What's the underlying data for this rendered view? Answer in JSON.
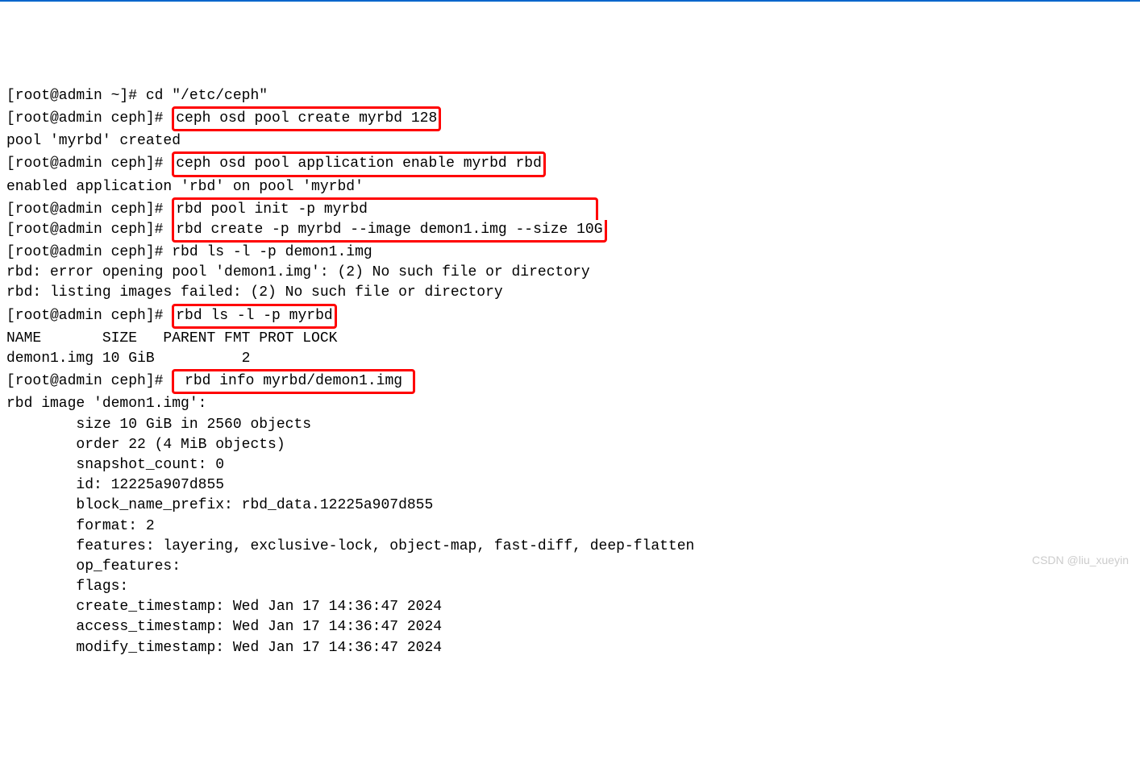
{
  "lines": [
    {
      "segments": [
        {
          "text": "[root@admin ~]# cd \"/etc/ceph\""
        }
      ]
    },
    {
      "segments": [
        {
          "text": "[root@admin ceph]# "
        },
        {
          "text": "ceph osd pool create myrbd 128",
          "highlight": true
        }
      ]
    },
    {
      "segments": [
        {
          "text": "pool 'myrbd' created"
        }
      ]
    },
    {
      "segments": [
        {
          "text": "[root@admin ceph]# "
        },
        {
          "text": "ceph osd pool application enable myrbd rbd",
          "highlight": true
        }
      ]
    },
    {
      "segments": [
        {
          "text": "enabled application 'rbd' on pool 'myrbd'"
        }
      ]
    },
    {
      "segments": [
        {
          "text": "[root@admin ceph]# "
        },
        {
          "text": "rbd pool init -p myrbd                          ",
          "highlight": true,
          "joinNext": true
        }
      ]
    },
    {
      "segments": [
        {
          "text": "[root@admin ceph]# "
        },
        {
          "text": "rbd create -p myrbd --image demon1.img --size 10G",
          "highlight": true,
          "joinPrev": true
        }
      ]
    },
    {
      "segments": [
        {
          "text": "[root@admin ceph]# rbd ls -l -p demon1.img"
        }
      ]
    },
    {
      "segments": [
        {
          "text": "rbd: error opening pool 'demon1.img': (2) No such file or directory"
        }
      ]
    },
    {
      "segments": [
        {
          "text": "rbd: listing images failed: (2) No such file or directory"
        }
      ]
    },
    {
      "segments": [
        {
          "text": "[root@admin ceph]# "
        },
        {
          "text": "rbd ls -l -p myrbd",
          "highlight": true
        }
      ]
    },
    {
      "segments": [
        {
          "text": "NAME       SIZE   PARENT FMT PROT LOCK"
        }
      ]
    },
    {
      "segments": [
        {
          "text": "demon1.img 10 GiB          2"
        }
      ]
    },
    {
      "segments": [
        {
          "text": "[root@admin ceph]# "
        },
        {
          "text": " rbd info myrbd/demon1.img ",
          "highlight": true
        }
      ]
    },
    {
      "segments": [
        {
          "text": "rbd image 'demon1.img':"
        }
      ]
    },
    {
      "segments": [
        {
          "text": "        size 10 GiB in 2560 objects"
        }
      ]
    },
    {
      "segments": [
        {
          "text": "        order 22 (4 MiB objects)"
        }
      ]
    },
    {
      "segments": [
        {
          "text": "        snapshot_count: 0"
        }
      ]
    },
    {
      "segments": [
        {
          "text": "        id: 12225a907d855"
        }
      ]
    },
    {
      "segments": [
        {
          "text": "        block_name_prefix: rbd_data.12225a907d855"
        }
      ]
    },
    {
      "segments": [
        {
          "text": "        format: 2"
        }
      ]
    },
    {
      "segments": [
        {
          "text": "        features: layering, exclusive-lock, object-map, fast-diff, deep-flatten"
        }
      ]
    },
    {
      "segments": [
        {
          "text": "        op_features:"
        }
      ]
    },
    {
      "segments": [
        {
          "text": "        flags:"
        }
      ]
    },
    {
      "segments": [
        {
          "text": "        create_timestamp: Wed Jan 17 14:36:47 2024"
        }
      ]
    },
    {
      "segments": [
        {
          "text": "        access_timestamp: Wed Jan 17 14:36:47 2024"
        }
      ]
    },
    {
      "segments": [
        {
          "text": "        modify_timestamp: Wed Jan 17 14:36:47 2024"
        }
      ]
    }
  ],
  "watermark": "CSDN @liu_xueyin"
}
